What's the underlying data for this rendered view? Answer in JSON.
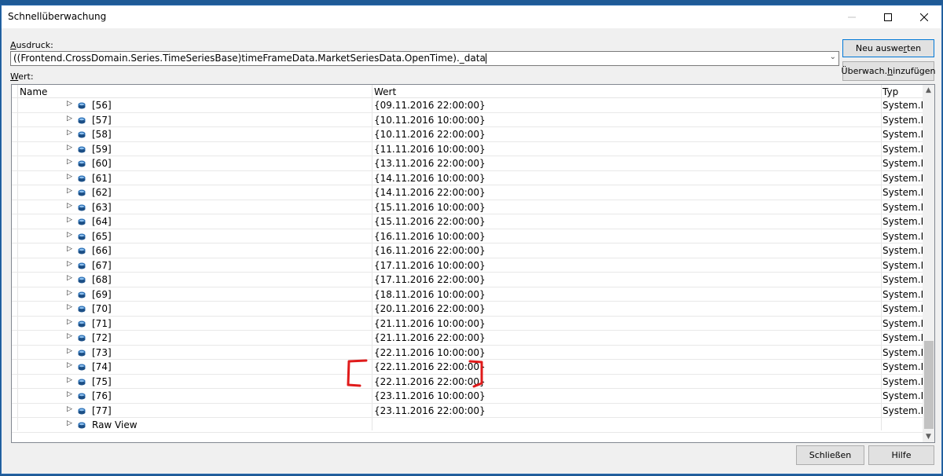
{
  "window": {
    "title": "Schnellüberwachung"
  },
  "expression": {
    "label_prefix": "A",
    "label_rest": "usdruck:",
    "value": "((Frontend.CrossDomain.Series.TimeSeriesBase)timeFrameData.MarketSeriesData.OpenTime)._data"
  },
  "value_label": {
    "prefix": "W",
    "rest": "ert:"
  },
  "buttons": {
    "reevaluate_a": "Neu auswe",
    "reevaluate_u": "r",
    "reevaluate_b": "ten",
    "add_watch_a": "Überwach. ",
    "add_watch_u": "h",
    "add_watch_b": "inzufügen",
    "close": "Schließen",
    "help": "Hilfe"
  },
  "grid": {
    "columns": {
      "name": "Name",
      "value": "Wert",
      "type": "Typ"
    },
    "rows": [
      {
        "name": "[56]",
        "value": "{09.11.2016 22:00:00}",
        "type": "System.DateTime"
      },
      {
        "name": "[57]",
        "value": "{10.11.2016 10:00:00}",
        "type": "System.DateTime"
      },
      {
        "name": "[58]",
        "value": "{10.11.2016 22:00:00}",
        "type": "System.DateTime"
      },
      {
        "name": "[59]",
        "value": "{11.11.2016 10:00:00}",
        "type": "System.DateTime"
      },
      {
        "name": "[60]",
        "value": "{13.11.2016 22:00:00}",
        "type": "System.DateTime"
      },
      {
        "name": "[61]",
        "value": "{14.11.2016 10:00:00}",
        "type": "System.DateTime"
      },
      {
        "name": "[62]",
        "value": "{14.11.2016 22:00:00}",
        "type": "System.DateTime"
      },
      {
        "name": "[63]",
        "value": "{15.11.2016 10:00:00}",
        "type": "System.DateTime"
      },
      {
        "name": "[64]",
        "value": "{15.11.2016 22:00:00}",
        "type": "System.DateTime"
      },
      {
        "name": "[65]",
        "value": "{16.11.2016 10:00:00}",
        "type": "System.DateTime"
      },
      {
        "name": "[66]",
        "value": "{16.11.2016 22:00:00}",
        "type": "System.DateTime"
      },
      {
        "name": "[67]",
        "value": "{17.11.2016 10:00:00}",
        "type": "System.DateTime"
      },
      {
        "name": "[68]",
        "value": "{17.11.2016 22:00:00}",
        "type": "System.DateTime"
      },
      {
        "name": "[69]",
        "value": "{18.11.2016 10:00:00}",
        "type": "System.DateTime"
      },
      {
        "name": "[70]",
        "value": "{20.11.2016 22:00:00}",
        "type": "System.DateTime"
      },
      {
        "name": "[71]",
        "value": "{21.11.2016 10:00:00}",
        "type": "System.DateTime"
      },
      {
        "name": "[72]",
        "value": "{21.11.2016 22:00:00}",
        "type": "System.DateTime"
      },
      {
        "name": "[73]",
        "value": "{22.11.2016 10:00:00}",
        "type": "System.DateTime"
      },
      {
        "name": "[74]",
        "value": "{22.11.2016 22:00:00}",
        "type": "System.DateTime"
      },
      {
        "name": "[75]",
        "value": "{22.11.2016 22:00:00}",
        "type": "System.DateTime"
      },
      {
        "name": "[76]",
        "value": "{23.11.2016 10:00:00}",
        "type": "System.DateTime"
      },
      {
        "name": "[77]",
        "value": "{23.11.2016 22:00:00}",
        "type": "System.DateTime"
      },
      {
        "name": "Raw View",
        "value": "",
        "type": ""
      }
    ]
  },
  "colors": {
    "annotation": "#e01b1b",
    "object_icon": "#2a6fb5"
  },
  "icons": {
    "expand": "triangle-right-icon",
    "object": "object-cube-icon",
    "dropdown": "chevron-down-icon"
  }
}
